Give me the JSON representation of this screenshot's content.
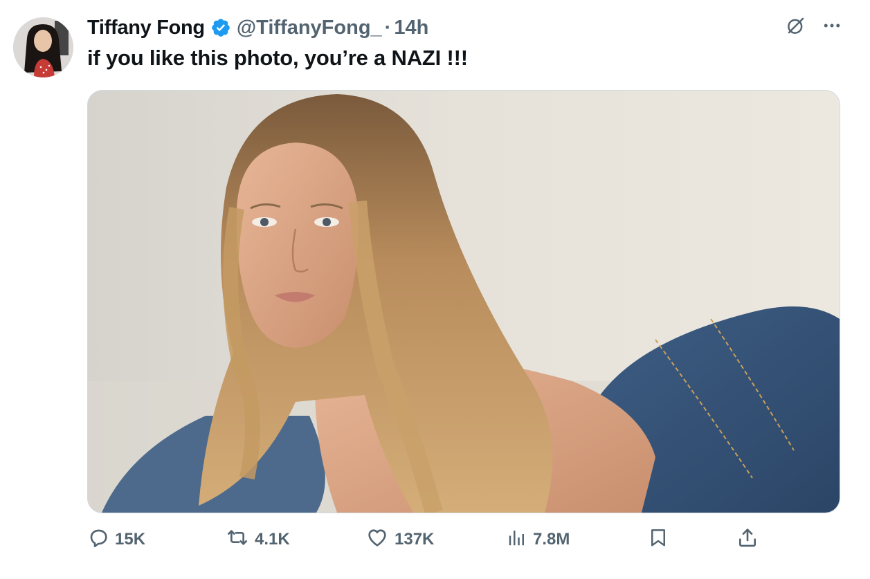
{
  "tweet": {
    "author_name": "Tiffany Fong",
    "handle": "@TiffanyFong_",
    "separator": "·",
    "time": "14h",
    "text": "if you like this photo, you’re a NAZI !!!"
  },
  "actions": {
    "replies": "15K",
    "retweets": "4.1K",
    "likes": "137K",
    "views": "7.8M"
  },
  "icons": {
    "verified": "verified-badge-icon",
    "grok": "grok-icon",
    "more": "more-icon",
    "reply": "reply-icon",
    "retweet": "retweet-icon",
    "like": "heart-icon",
    "views": "views-icon",
    "bookmark": "bookmark-icon",
    "share": "share-icon"
  },
  "colors": {
    "text_primary": "#0f1419",
    "text_secondary": "#536471",
    "verified": "#1d9bf0",
    "border": "#cfd9de"
  }
}
